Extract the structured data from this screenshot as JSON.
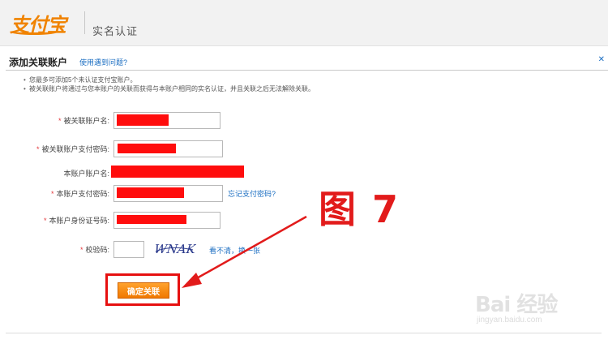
{
  "header": {
    "logo": "支付宝",
    "subtitle": "实名认证"
  },
  "dialog": {
    "title": "添加关联账户",
    "help_link": "使用遇到问题?",
    "close_label": "关闭",
    "notes": [
      "您最多可添加5个未认证支付宝账户。",
      "被关联账户将通过与您本账户的关联而获得与本账户相同的实名认证，并且关联之后无法解除关联。"
    ]
  },
  "form": {
    "fields": [
      {
        "label": "被关联账户名:",
        "required": true
      },
      {
        "label": "被关联账户支付密码:",
        "required": true
      },
      {
        "label": "本账户账户名:",
        "required": false
      },
      {
        "label": "本账户支付密码:",
        "required": true
      },
      {
        "label": "本账户身份证号码:",
        "required": true
      },
      {
        "label": "校验码:",
        "required": true
      }
    ],
    "forgot_password_link": "忘记支付密码?",
    "captcha_text": "WNAK",
    "captcha_refresh": "看不清，换一张",
    "submit_label": "确定关联",
    "required_mark": "*"
  },
  "annotation": {
    "figure_label": "图 7"
  },
  "watermark": {
    "main": "Bai 经验",
    "sub": "jingyan.baidu.com"
  },
  "colors": {
    "accent": "#f08300",
    "link": "#1b6ec2",
    "annotation": "#e21b1b",
    "redaction": "#ff0d0d"
  }
}
